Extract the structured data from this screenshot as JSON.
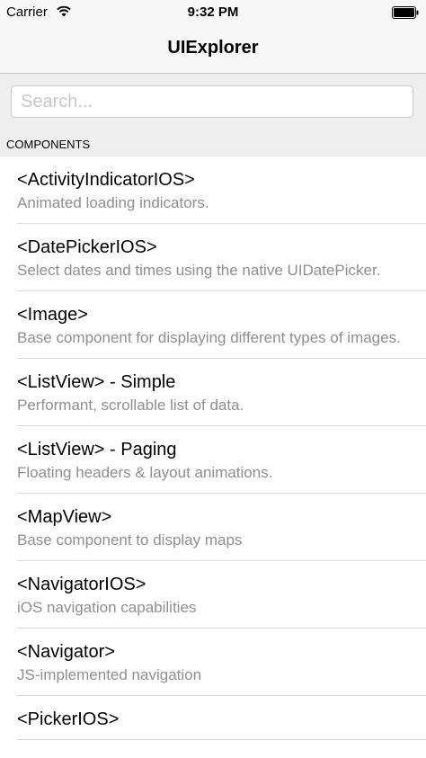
{
  "status_bar": {
    "carrier": "Carrier",
    "time": "9:32 PM",
    "wifi_icon": "wifi-icon",
    "battery_icon": "battery-icon"
  },
  "nav_bar": {
    "title": "UIExplorer"
  },
  "search": {
    "placeholder": "Search...",
    "value": ""
  },
  "section": {
    "label": "COMPONENTS"
  },
  "components": [
    {
      "title": "<ActivityIndicatorIOS>",
      "description": "Animated loading indicators."
    },
    {
      "title": "<DatePickerIOS>",
      "description": "Select dates and times using the native UIDatePicker."
    },
    {
      "title": "<Image>",
      "description": "Base component for displaying different types of images."
    },
    {
      "title": "<ListView> - Simple",
      "description": "Performant, scrollable list of data."
    },
    {
      "title": "<ListView> - Paging",
      "description": "Floating headers & layout animations."
    },
    {
      "title": "<MapView>",
      "description": "Base component to display maps"
    },
    {
      "title": "<NavigatorIOS>",
      "description": "iOS navigation capabilities"
    },
    {
      "title": "<Navigator>",
      "description": "JS-implemented navigation"
    },
    {
      "title": "<PickerIOS>",
      "description": ""
    }
  ]
}
